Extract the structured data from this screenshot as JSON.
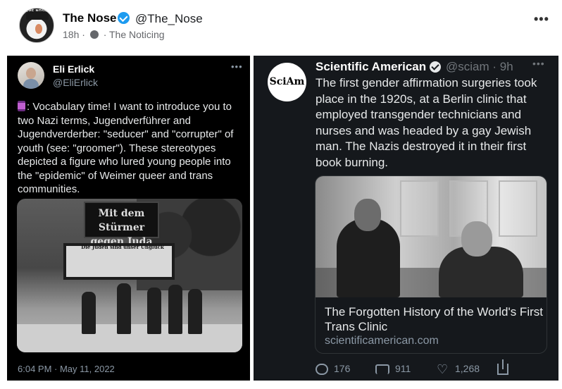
{
  "post": {
    "author_name": "The Nose",
    "author_handle": "@The_Nose",
    "avatar_text": "THE NOSE KNOWS",
    "time": "18h",
    "separator": "·",
    "group": "· The Noticing",
    "more_label": "•••"
  },
  "left_tweet": {
    "author_name": "Eli Erlick",
    "author_handle": "@EliErlick",
    "more_label": "•••",
    "text": ": Vocabulary time! I want to introduce you to two Nazi terms, Jugendverführer and Jugendverderber: \"seducer\" and \"corrupter\" of youth (see: \"groomer\"). These stereotypes depicted a figure who lured young people into the \"epidemic\" of Weimer queer and trans communities.",
    "image_sign_line1": "Mit dem Stürmer",
    "image_sign_line2": "gegen Juda",
    "image_board_text": "Die Juden sind unser Unglück",
    "date": "6:04 PM · May 11, 2022"
  },
  "right_tweet": {
    "avatar_text": "SciAm",
    "author_name": "Scientific American",
    "author_handle": "@sciam · 9h",
    "more_label": "•••",
    "text": "The first gender affirmation surgeries took place in the 1920s, at a Berlin clinic that employed transgender technicians and nurses and was headed by a gay Jewish man. The Nazis destroyed it in their first book burning.",
    "link_title": "The Forgotten History of the World's First Trans Clinic",
    "link_domain": "scientificamerican.com",
    "replies": "176",
    "retweets": "911",
    "likes": "1,268",
    "like_icon": "♡"
  }
}
